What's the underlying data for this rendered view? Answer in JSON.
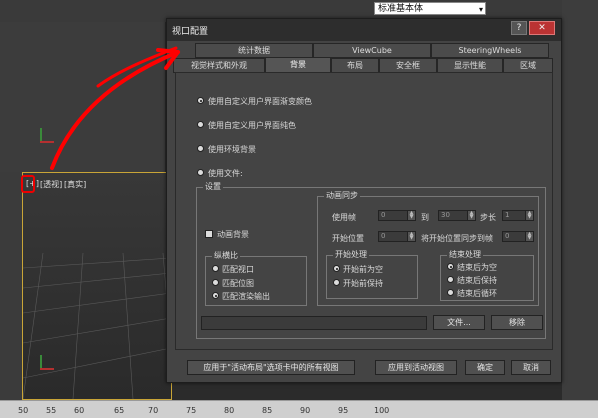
{
  "font_dropdown": {
    "value": "标准基本体"
  },
  "viewport": {
    "label_plus": "[+]",
    "label_view": "[透视]",
    "label_shading": "[真实]"
  },
  "ruler": {
    "ticks": [
      "50",
      "55",
      "60",
      "65",
      "70",
      "75",
      "80",
      "85",
      "90",
      "95",
      "100"
    ]
  },
  "dialog": {
    "title": "视口配置",
    "help": "?",
    "close": "✕",
    "tabs_row1": [
      "统计数据",
      "ViewCube",
      "SteeringWheels"
    ],
    "tabs_row2": [
      "视觉样式和外观",
      "背景",
      "布局",
      "安全框",
      "显示性能",
      "区域"
    ],
    "active_tab": "背景",
    "options": [
      {
        "label": "使用自定义用户界面渐变颜色",
        "selected": true
      },
      {
        "label": "使用自定义用户界面纯色",
        "selected": false
      },
      {
        "label": "使用环境背景",
        "selected": false
      },
      {
        "label": "使用文件:",
        "selected": false
      }
    ],
    "settings": {
      "title": "设置",
      "animate_bg_label": "动画背景",
      "animate_bg_checked": false,
      "aspect": {
        "title": "纵横比",
        "options": [
          {
            "label": "匹配视口",
            "selected": false
          },
          {
            "label": "匹配位图",
            "selected": false
          },
          {
            "label": "匹配渲染输出",
            "selected": true
          }
        ]
      },
      "anim_sync": {
        "title": "动画同步",
        "use_frame_label": "使用帧",
        "use_frame_from": "0",
        "to_label": "到",
        "use_frame_to": "30",
        "step_label": "步长",
        "step_value": "1",
        "start_label": "开始位置",
        "start_value": "0",
        "sync_label": "将开始位置同步到帧",
        "sync_value": "0"
      },
      "start_proc": {
        "title": "开始处理",
        "options": [
          {
            "label": "开始前为空",
            "selected": true
          },
          {
            "label": "开始前保持",
            "selected": false
          }
        ]
      },
      "end_proc": {
        "title": "结束处理",
        "options": [
          {
            "label": "结束后为空",
            "selected": true
          },
          {
            "label": "结束后保持",
            "selected": false
          },
          {
            "label": "结束后循环",
            "selected": false
          }
        ]
      },
      "file_btn": "文件...",
      "remove_btn": "移除"
    },
    "apply_all": "应用于\"活动布局\"选项卡中的所有视图",
    "apply_active": "应用到活动视图",
    "ok": "确定",
    "cancel": "取消"
  }
}
